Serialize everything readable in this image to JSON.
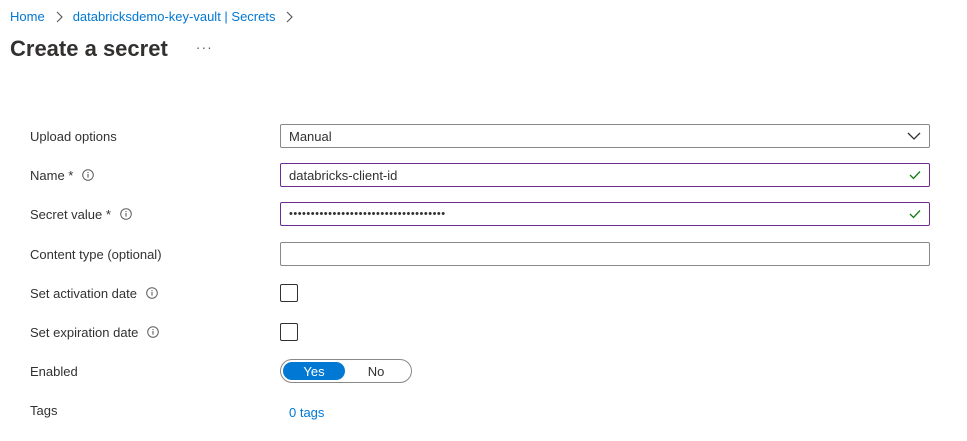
{
  "breadcrumb": {
    "items": [
      {
        "label": "Home"
      },
      {
        "label": "databricksdemo-key-vault | Secrets"
      }
    ]
  },
  "page": {
    "title": "Create a secret",
    "more_label": "···"
  },
  "form": {
    "upload_options": {
      "label": "Upload options",
      "value": "Manual"
    },
    "name": {
      "label": "Name *",
      "value": "databricks-client-id"
    },
    "secret_value": {
      "label": "Secret value *",
      "value": "••••••••••••••••••••••••••••••••••••"
    },
    "content_type": {
      "label": "Content type (optional)",
      "value": ""
    },
    "activation_date": {
      "label": "Set activation date",
      "checked": false
    },
    "expiration_date": {
      "label": "Set expiration date",
      "checked": false
    },
    "enabled": {
      "label": "Enabled",
      "options": [
        "Yes",
        "No"
      ],
      "selected": "Yes"
    },
    "tags": {
      "label": "Tags",
      "link": "0 tags"
    }
  },
  "colors": {
    "accent": "#0078d4",
    "valid_border": "#6b2c91",
    "valid_check": "#107c10"
  }
}
